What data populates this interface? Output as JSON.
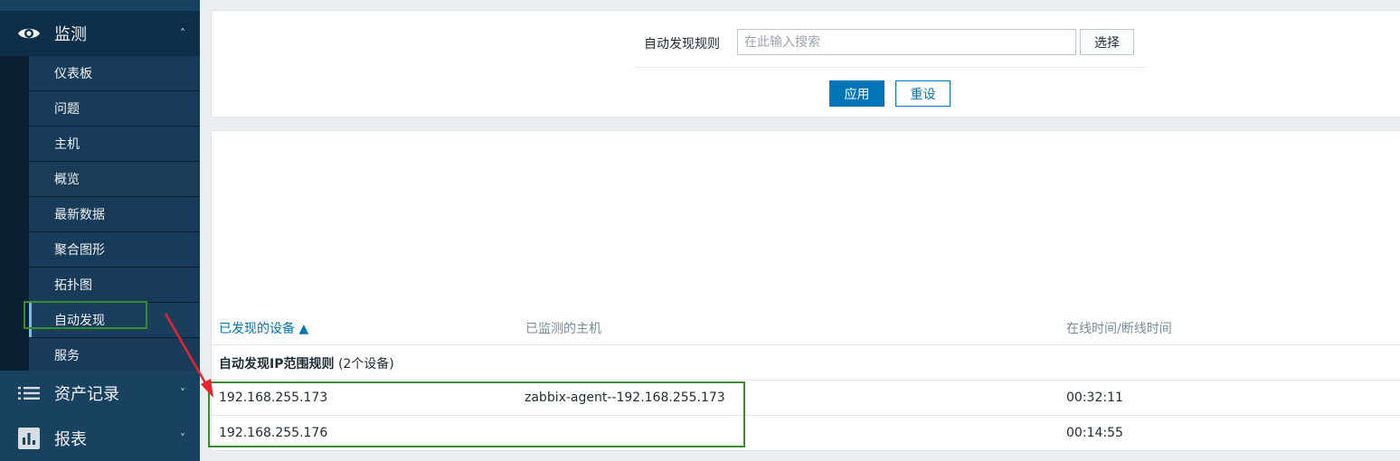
{
  "sidebar": {
    "monitor": {
      "label": "监测",
      "icon": "eye-icon",
      "arrow": "˄"
    },
    "submenu": [
      {
        "label": "仪表板"
      },
      {
        "label": "问题"
      },
      {
        "label": "主机"
      },
      {
        "label": "概览"
      },
      {
        "label": "最新数据"
      },
      {
        "label": "聚合图形"
      },
      {
        "label": "拓扑图"
      },
      {
        "label": "自动发现",
        "selected": true
      },
      {
        "label": "服务"
      }
    ],
    "inventory": {
      "label": "资产记录",
      "icon": "list-icon",
      "arrow": "˅"
    },
    "reports": {
      "label": "报表",
      "icon": "bar-chart-icon",
      "arrow": "˅"
    }
  },
  "filter": {
    "label": "自动发现规则",
    "placeholder": "在此输入搜索",
    "select_label": "选择",
    "apply_label": "应用",
    "reset_label": "重设"
  },
  "table": {
    "columns": {
      "device": "已发现的设备 ▲",
      "host": "已监测的主机",
      "time": "在线时间/断线时间"
    },
    "group": {
      "name": "自动发现IP范围规则",
      "count": "(2个设备)"
    },
    "rows": [
      {
        "device": "192.168.255.173",
        "host": "zabbix-agent--192.168.255.173",
        "time": "00:32:11"
      },
      {
        "device": "192.168.255.176",
        "host": "",
        "time": "00:14:55"
      }
    ]
  },
  "colors": {
    "accent": "#0275b8",
    "sidebar": "#0e2f49",
    "annotation_box": "#3b8a2c",
    "annotation_arrow": "#e8232b"
  }
}
